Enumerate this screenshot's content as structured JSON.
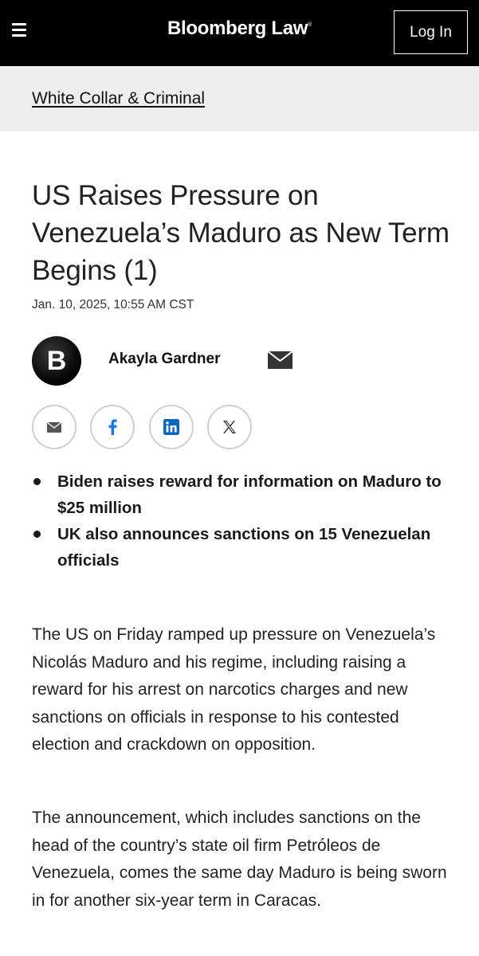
{
  "header": {
    "logo_text": "Bloomberg Law",
    "logo_mark": "®",
    "login_label": "Log In"
  },
  "section": {
    "label": "White Collar & Criminal"
  },
  "article": {
    "headline": "US Raises Pressure on Venezuela’s Maduro as New Term Begins (1)",
    "date": "Jan. 10, 2025, 10:55 AM CST",
    "author": {
      "initial": "B",
      "name": "Akayla Gardner"
    },
    "share_icons": [
      "email-icon",
      "facebook-icon",
      "linkedin-icon",
      "x-icon"
    ],
    "bullets": [
      "Biden raises reward for information on Maduro to $25 million",
      "UK also announces sanctions on 15 Venezuelan officials"
    ],
    "paragraphs": [
      "The US on Friday ramped up pressure on Venezuela’s Nicolás Maduro and his regime, including raising a reward for his arrest on narcotics charges and new sanctions on officials in response to his contested election and crackdown on opposition.",
      "The announcement, which includes sanctions on the head of the country’s state oil firm Petróleos de Venezuela, comes the same day Maduro is being sworn in for another six-year term in Caracas."
    ]
  },
  "colors": {
    "header_bg": "#000000",
    "section_bg": "#eeeeee",
    "text": "#1a1a1a",
    "share_border": "#cfcfcf",
    "facebook": "#1877f2",
    "linkedin": "#0a66c2"
  }
}
